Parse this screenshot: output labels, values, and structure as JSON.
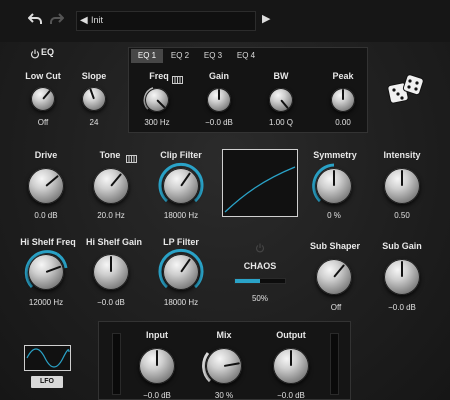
{
  "topbar": {
    "undo_icon": "undo-arrow",
    "redo_icon": "redo-arrow",
    "preset_name": "Init",
    "prev_icon": "triangle-left",
    "next_icon": "triangle-right"
  },
  "eq": {
    "title": "EQ",
    "power_icon": "power-icon",
    "low_cut": {
      "label": "Low Cut",
      "value": "Off"
    },
    "slope": {
      "label": "Slope",
      "value": "24"
    },
    "tabs": [
      "EQ 1",
      "EQ 2",
      "EQ 3",
      "EQ 4"
    ],
    "active_tab": "EQ 1",
    "freq": {
      "label": "Freq",
      "value": "300 Hz",
      "icon": "piano-icon"
    },
    "gain": {
      "label": "Gain",
      "value": "−0.0 dB"
    },
    "bw": {
      "label": "BW",
      "value": "1.00 Q"
    },
    "peak": {
      "label": "Peak",
      "value": "0.00"
    }
  },
  "dice_icon": "dice-icon",
  "drive": {
    "label": "Drive",
    "value": "0.0 dB"
  },
  "tone": {
    "label": "Tone",
    "value": "20.0 Hz",
    "icon": "piano-icon"
  },
  "clip_filter": {
    "label": "Clip Filter",
    "value": "18000 Hz"
  },
  "symmetry": {
    "label": "Symmetry",
    "value": "0 %"
  },
  "intensity": {
    "label": "Intensity",
    "value": "0.50"
  },
  "hi_shelf_freq": {
    "label": "Hi Shelf Freq",
    "value": "12000 Hz"
  },
  "hi_shelf_gain": {
    "label": "Hi Shelf Gain",
    "value": "−0.0 dB"
  },
  "lp_filter": {
    "label": "LP Filter",
    "value": "18000 Hz"
  },
  "chaos": {
    "label": "CHAOS",
    "value": "50%",
    "level": 0.5,
    "power_icon": "power-icon"
  },
  "sub_shaper": {
    "label": "Sub Shaper",
    "value": "Off"
  },
  "sub_gain": {
    "label": "Sub Gain",
    "value": "−0.0 dB"
  },
  "lfo": {
    "button_label": "LFO",
    "wave": "sine"
  },
  "input": {
    "label": "Input",
    "value": "−0.0 dB"
  },
  "mix": {
    "label": "Mix",
    "value": "30 %"
  },
  "output": {
    "label": "Output",
    "value": "−0.0 dB"
  },
  "colors": {
    "accent": "#2aa3c8",
    "background": "#222222",
    "text": "#e6e6e6"
  }
}
